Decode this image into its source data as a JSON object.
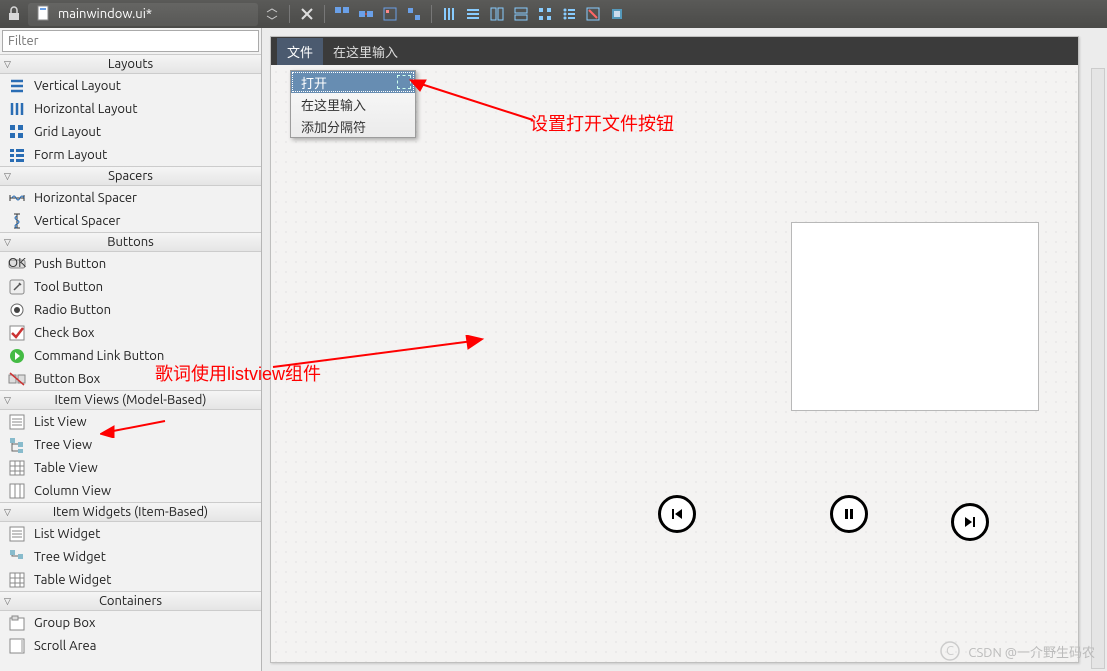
{
  "colors": {
    "annotation": "#ff0000"
  },
  "window": {
    "title": "mainwindow.ui*"
  },
  "toolbar": {
    "icons": [
      "new",
      "edit-copy",
      "edit-cut",
      "edit-paste",
      "layout-h",
      "layout-v",
      "layout-hsplit",
      "layout-vsplit",
      "grid-1",
      "grid-2",
      "adjust-size",
      "break-layout"
    ]
  },
  "filter": {
    "placeholder": "Filter",
    "value": ""
  },
  "widget_tree": {
    "categories": [
      {
        "name": "Layouts",
        "items": [
          "Vertical Layout",
          "Horizontal Layout",
          "Grid Layout",
          "Form Layout"
        ]
      },
      {
        "name": "Spacers",
        "items": [
          "Horizontal Spacer",
          "Vertical Spacer"
        ]
      },
      {
        "name": "Buttons",
        "items": [
          "Push Button",
          "Tool Button",
          "Radio Button",
          "Check Box",
          "Command Link Button",
          "Button Box"
        ]
      },
      {
        "name": "Item Views (Model-Based)",
        "items": [
          "List View",
          "Tree View",
          "Table View",
          "Column View"
        ]
      },
      {
        "name": "Item Widgets (Item-Based)",
        "items": [
          "List Widget",
          "Tree Widget",
          "Table Widget"
        ]
      },
      {
        "name": "Containers",
        "items": [
          "Group Box",
          "Scroll Area"
        ]
      }
    ]
  },
  "form": {
    "menu_bar": {
      "items": [
        "文件",
        "在这里输入"
      ],
      "active_index": 0
    },
    "dropdown": {
      "items": [
        "打开",
        "在这里输入",
        "添加分隔符"
      ],
      "selected_index": 0
    },
    "buttons": {
      "prev": "previous",
      "pause": "pause",
      "next": "next"
    }
  },
  "annotations": {
    "a1": "设置打开文件按钮",
    "a2": "歌词使用listview组件"
  },
  "watermark": {
    "text": "CSDN @一介野生码农"
  }
}
